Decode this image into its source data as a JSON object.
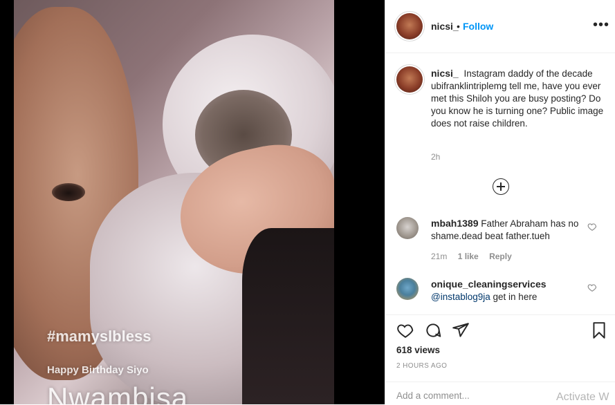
{
  "post": {
    "overlay_lines": [
      "#mamyslbless",
      "Happy Birthday Siyo",
      "Nwambisa"
    ]
  },
  "header": {
    "username": "nicsi_",
    "separator": "•",
    "follow_label": "Follow",
    "more_icon": "more-options-icon",
    "more_glyph": "•••"
  },
  "caption": {
    "username": "nicsi_",
    "text": "Instagram daddy of the decade ubifranklintriplemg tell me, have you ever met this Shiloh you are busy posting? Do you know he is turning one? Public image does not raise children.",
    "time": "2h"
  },
  "load_more_icon": "plus-circle-icon",
  "comments": [
    {
      "username": "mbah1389",
      "text": "Father Abraham has no shame.dead beat father.tueh",
      "time": "21m",
      "likes": "1 like",
      "reply": "Reply"
    },
    {
      "username": "onique_cleaningservices",
      "mention": "@instablog9ja",
      "text": "get in here"
    }
  ],
  "actions": {
    "like_icon": "heart-icon",
    "comment_icon": "comment-icon",
    "share_icon": "share-icon",
    "save_icon": "bookmark-icon"
  },
  "views": "618 views",
  "post_time": "2 HOURS AGO",
  "add_comment": {
    "placeholder": "Add a comment..."
  },
  "watermark": "Activate W",
  "colors": {
    "accent": "#0095f6",
    "text": "#262626",
    "secondary": "#8e8e8e",
    "border": "#efefef",
    "media_bg": "#000000"
  }
}
